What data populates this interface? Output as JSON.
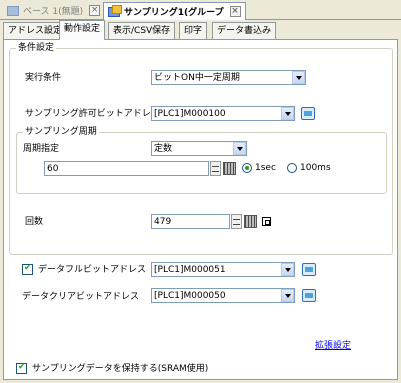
{
  "doc_tabs": [
    {
      "label": "ベース 1(無題)",
      "state": "inactive"
    },
    {
      "label": "サンプリング1(グループ",
      "state": "active"
    }
  ],
  "setting_tabs": [
    "アドレス設定",
    "動作設定",
    "表示/CSV保存",
    "印字",
    "データ書込み"
  ],
  "active_setting_tab": "動作設定",
  "condition_group": {
    "legend": "条件設定",
    "exec_condition_label": "実行条件",
    "exec_condition_value": "ビットON中一定周期",
    "sampling_enable_label": "サンプリング許可ビットアドレス",
    "sampling_enable_value": "[PLC1]M000100",
    "period_group": {
      "legend": "サンプリング周期",
      "period_spec_label": "周期指定",
      "period_spec_value": "定数",
      "period_value": "60",
      "unit_options": [
        "1sec",
        "100ms"
      ],
      "selected_unit": "1sec"
    },
    "count_label": "回数",
    "count_value": "479"
  },
  "data_full": {
    "checked": true,
    "label": "データフルビットアドレス",
    "value": "[PLC1]M000051"
  },
  "data_clear": {
    "label": "データクリアビットアドレス",
    "value": "[PLC1]M000050"
  },
  "extended_settings_link": "拡張設定",
  "retain_data": {
    "checked": true,
    "label": "サンプリングデータを保持する(SRAM使用)"
  },
  "colors": {
    "window_bg": "#ece9d8",
    "panel_bg": "#ffffff",
    "link": "#0000ee"
  }
}
